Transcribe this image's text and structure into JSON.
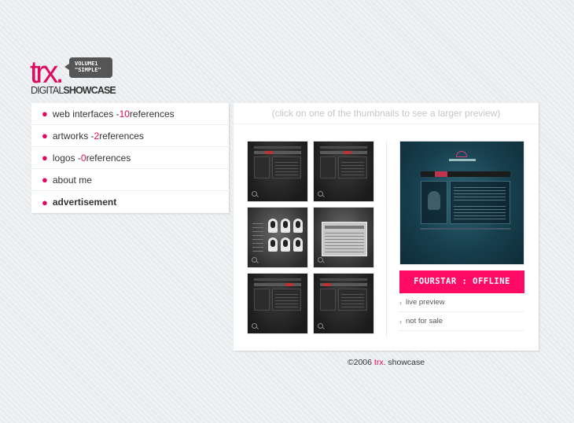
{
  "logo": {
    "main": "trx",
    "dot": ".",
    "sub_light": "DIGITAL",
    "sub_bold": "SHOWCASE",
    "bubble_line1": "VOLUME1",
    "bubble_line2": "\"SIMPLE\""
  },
  "nav": {
    "items": [
      {
        "prefix": "web interfaces - ",
        "count": "10",
        "suffix": " references"
      },
      {
        "prefix": "artworks - ",
        "count": "2",
        "suffix": " references"
      },
      {
        "prefix": "logos - ",
        "count": "0",
        "suffix": " references"
      },
      {
        "label": "about me"
      },
      {
        "label": "advertisement"
      }
    ]
  },
  "main": {
    "hint": "(click on one of the thumbnails to see a larger preview)",
    "project_title": "FOURSTAR : OFFLINE",
    "links": [
      {
        "label": "live preview"
      },
      {
        "label": "not for sale"
      }
    ]
  },
  "footer": {
    "prefix": "©2006 ",
    "brand": "trx.",
    "suffix": " showcase"
  },
  "colors": {
    "accent": "#e0095f",
    "title_bar": "#ff0a64",
    "background": "#e9ecee"
  }
}
